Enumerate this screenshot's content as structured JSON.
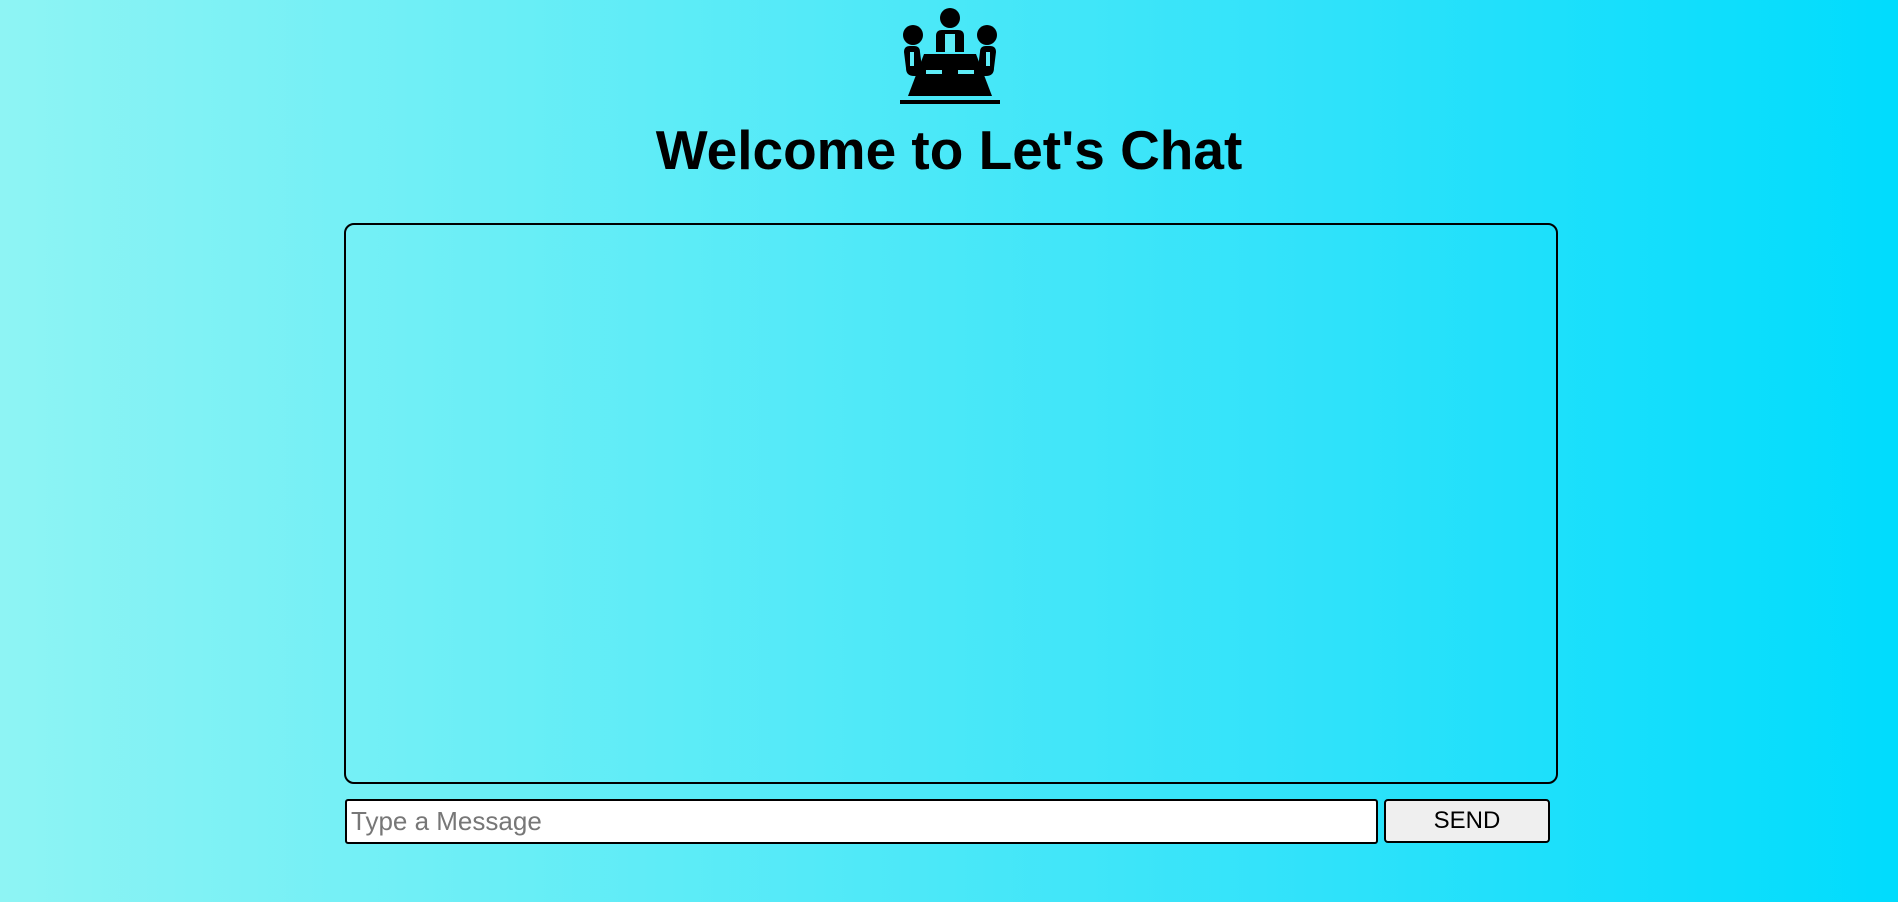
{
  "header": {
    "logo_icon": "meeting-table-people-icon",
    "title": "Welcome to Let's Chat"
  },
  "chat": {
    "messages": []
  },
  "composer": {
    "input_value": "",
    "input_placeholder": "Type a Message",
    "send_label": "SEND"
  },
  "colors": {
    "background_start": "#8ef4f4",
    "background_end": "#00dcfd",
    "border": "#000000",
    "button_bg": "#efefef"
  }
}
